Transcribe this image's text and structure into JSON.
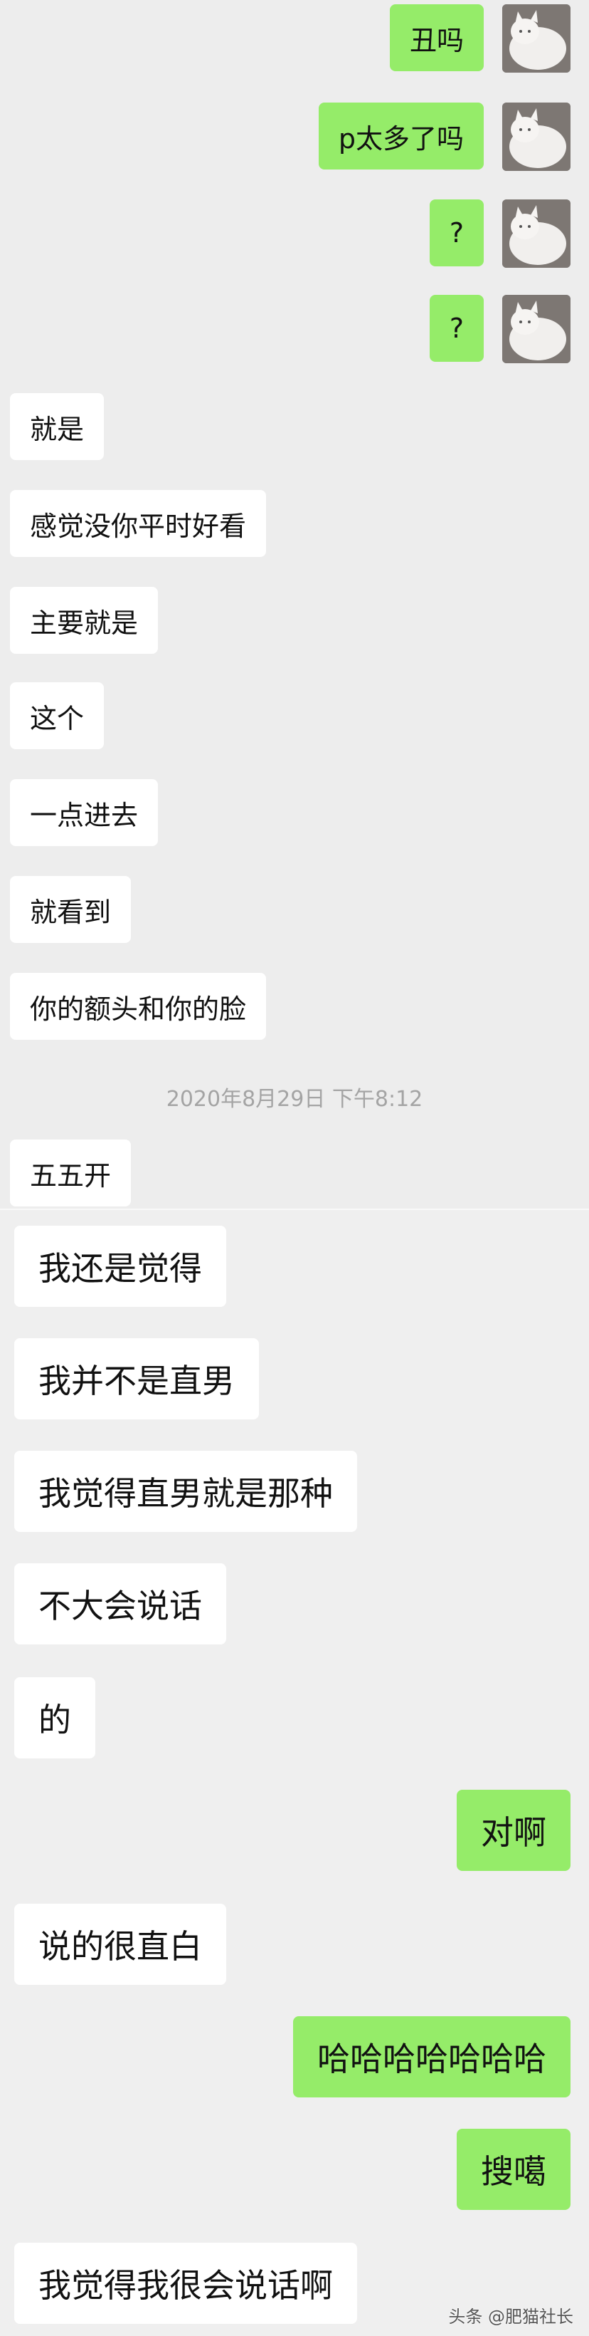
{
  "chat": {
    "messages_a": [
      {
        "side": "right",
        "text": "丑吗"
      },
      {
        "side": "right",
        "text": "p太多了吗"
      },
      {
        "side": "right",
        "text": "?"
      },
      {
        "side": "right",
        "text": "?"
      },
      {
        "side": "left",
        "text": "就是"
      },
      {
        "side": "left",
        "text": "感觉没你平时好看"
      },
      {
        "side": "left",
        "text": "主要就是"
      },
      {
        "side": "left",
        "text": "这个"
      },
      {
        "side": "left",
        "text": "一点进去"
      },
      {
        "side": "left",
        "text": "就看到"
      },
      {
        "side": "left",
        "text": "你的额头和你的脸"
      },
      {
        "side": "left",
        "text": "五五开"
      }
    ],
    "timestamp": "2020年8月29日 下午8:12",
    "messages_b": [
      {
        "side": "left",
        "text": "我还是觉得"
      },
      {
        "side": "left",
        "text": "我并不是直男"
      },
      {
        "side": "left",
        "text": "我觉得直男就是那种"
      },
      {
        "side": "left",
        "text": "不大会说话"
      },
      {
        "side": "left",
        "text": "的"
      },
      {
        "side": "right",
        "text": "对啊"
      },
      {
        "side": "left",
        "text": "说的很直白"
      },
      {
        "side": "right",
        "text": "哈哈哈哈哈哈哈"
      },
      {
        "side": "right",
        "text": "搜噶"
      },
      {
        "side": "left",
        "text": "我觉得我很会说话啊"
      }
    ]
  },
  "watermark": "头条 @肥猫社长",
  "colors": {
    "sent_bubble": "#95ec69",
    "received_bubble": "#ffffff",
    "background": "#ededed",
    "timestamp_text": "#a4a4a4"
  },
  "icons": {
    "avatar": "white-cat-photo-avatar"
  }
}
